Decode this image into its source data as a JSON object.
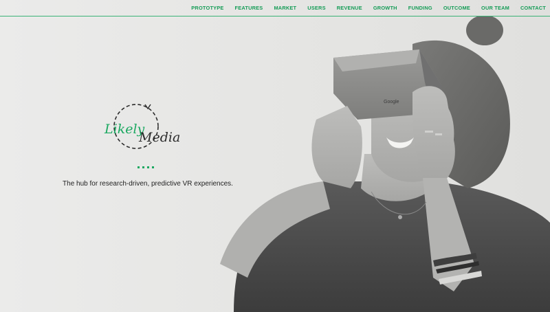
{
  "nav": {
    "items": [
      "PROTOTYPE",
      "FEATURES",
      "MARKET",
      "USERS",
      "REVENUE",
      "GROWTH",
      "FUNDING",
      "OUTCOME",
      "OUR TEAM",
      "CONTACT"
    ]
  },
  "logo": {
    "word1": "Likely",
    "word2": "Media"
  },
  "headset": {
    "brand": "Google"
  },
  "hero": {
    "tagline": "The hub for research-driven, predictive VR experiences."
  },
  "colors": {
    "accent": "#1aa860",
    "text": "#222222",
    "background": "#e6e6e4"
  }
}
